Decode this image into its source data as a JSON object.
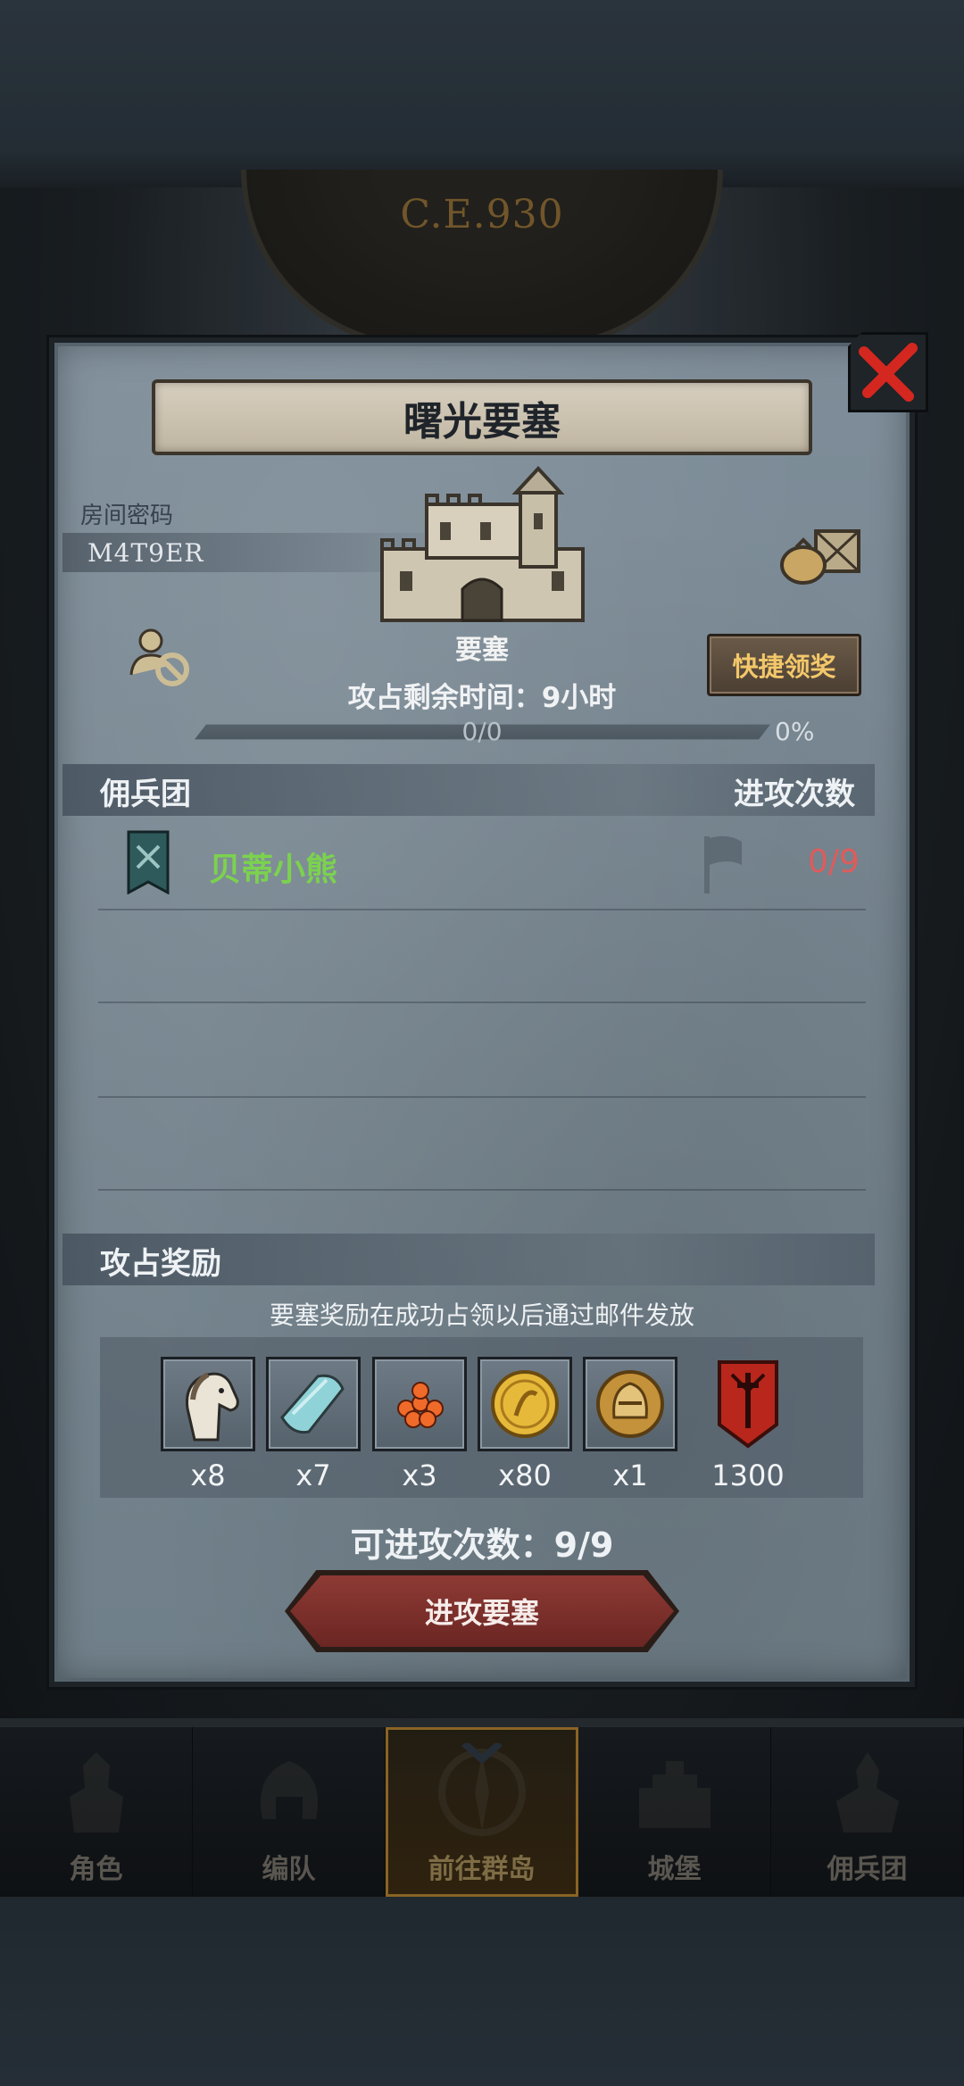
{
  "background": {
    "era": "C.E.930"
  },
  "nav": {
    "items": [
      {
        "label": "角色",
        "icon": "knight-icon"
      },
      {
        "label": "编队",
        "icon": "helmet-icon"
      },
      {
        "label": "前往群岛",
        "icon": "compass-icon",
        "active": true
      },
      {
        "label": "城堡",
        "icon": "castle-icon"
      },
      {
        "label": "佣兵团",
        "icon": "warrior-icon"
      }
    ]
  },
  "modal": {
    "title": "曙光要塞",
    "room_label": "房间密码",
    "room_code": "M4T9ER",
    "fort_label": "要塞",
    "quick_claim": "快捷领奖",
    "time_prefix": "攻占剩余时间：",
    "time_value": "9",
    "time_unit": "小时",
    "progress_text": "0/0",
    "progress_value": 0,
    "progress_percent": "0%",
    "mercenary_header": "佣兵团",
    "attack_count_header": "进攻次数",
    "mercenaries": [
      {
        "name": "贝蒂小熊",
        "attacks": "0/9"
      }
    ],
    "reward_header": "攻占奖励",
    "reward_note": "要塞奖励在成功占领以后通过邮件发放",
    "rewards": [
      {
        "icon": "horse-icon",
        "count": "x8"
      },
      {
        "icon": "cloth-icon",
        "count": "x7"
      },
      {
        "icon": "roe-icon",
        "count": "x3"
      },
      {
        "icon": "gold-coin-icon",
        "count": "x80"
      },
      {
        "icon": "helmet-coin-icon",
        "count": "x1"
      },
      {
        "icon": "banner-sword-icon",
        "count": "1300"
      }
    ],
    "attacks_available_label": "可进攻次数：",
    "attacks_available_value": "9/9",
    "attack_button": "进攻要塞"
  },
  "colors": {
    "accent_gold": "#f3c76a",
    "merc_name_green": "#7bd24e",
    "attack_count_red": "#e05b5b",
    "close_red": "#d4271f"
  }
}
